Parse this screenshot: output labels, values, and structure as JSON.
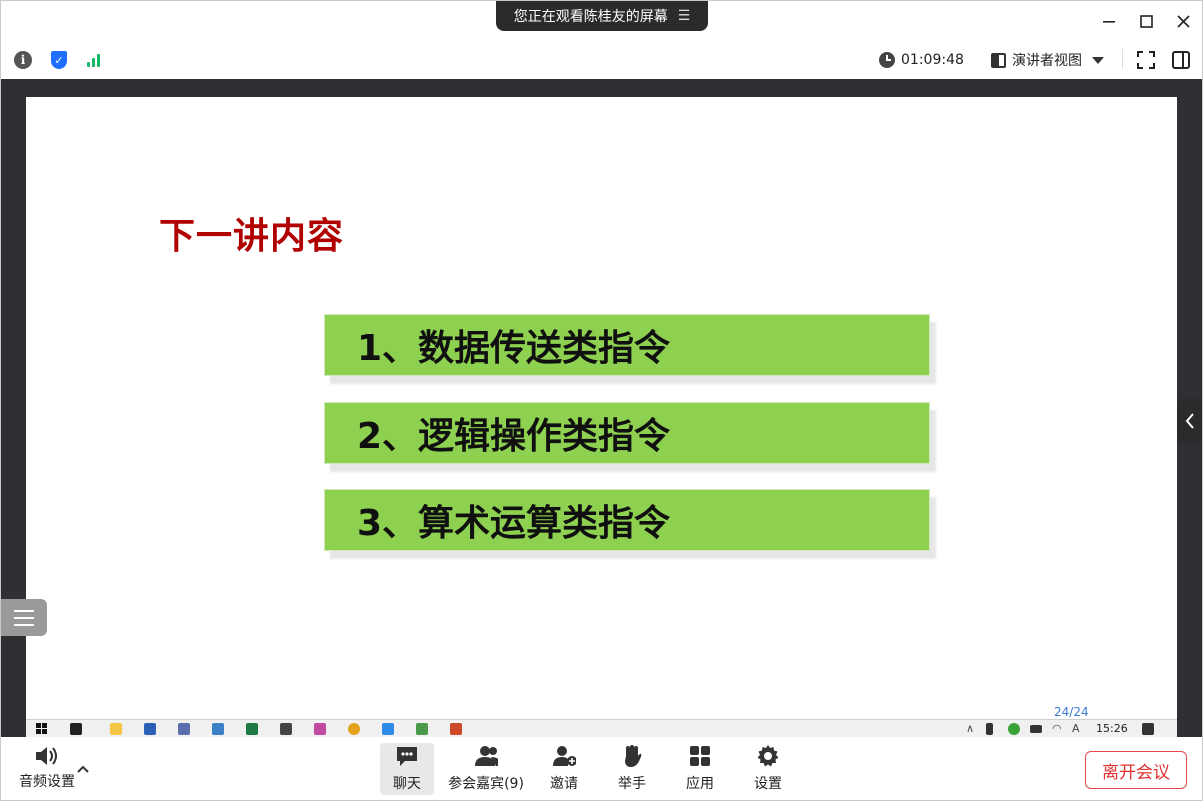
{
  "share_banner": {
    "text": "您正在观看陈桂友的屏幕",
    "menu_icon": "list-icon"
  },
  "window_controls": {
    "minimize": "—",
    "maximize": "☐",
    "close": "✕"
  },
  "infobar": {
    "elapsed_time": "01:09:48",
    "view_mode": "演讲者视图"
  },
  "slide": {
    "title": "下一讲内容",
    "items": [
      {
        "label": "1、数据传送类指令"
      },
      {
        "label": "2、逻辑操作类指令"
      },
      {
        "label": "3、算术运算类指令"
      }
    ],
    "page": "24/24",
    "colors": {
      "title": "#b00000",
      "item_bg": "#8ed04f"
    }
  },
  "taskbar": {
    "time": "15:26"
  },
  "toolbar": {
    "audio_label": "音频设置",
    "chat": "聊天",
    "participants": "参会嘉宾(9)",
    "invite": "邀请",
    "raise_hand": "举手",
    "apps": "应用",
    "settings": "设置",
    "leave": "离开会议"
  }
}
